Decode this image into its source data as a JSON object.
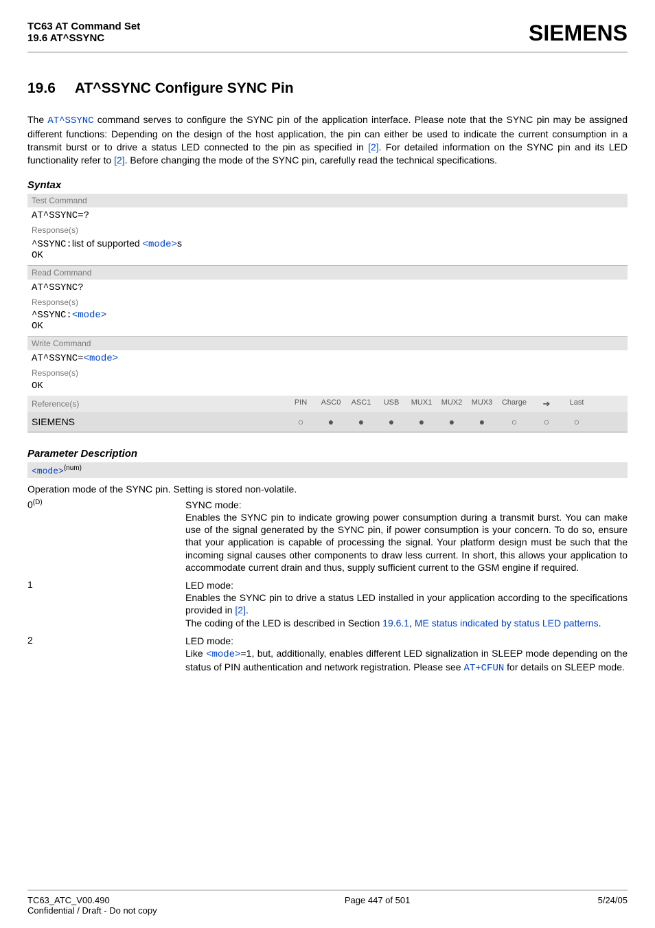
{
  "header": {
    "title": "TC63 AT Command Set",
    "subtitle": "19.6 AT^SSYNC",
    "brand": "SIEMENS"
  },
  "section": {
    "number": "19.6",
    "title": "AT^SSYNC   Configure SYNC Pin"
  },
  "intro": {
    "part1_a": "The ",
    "part1_cmd": "AT^SSYNC",
    "part1_b": " command serves to configure the SYNC pin of the application interface. Please note that the SYNC pin may be assigned different functions: Depending on the design of the host application, the pin can either be used to indicate the current consumption in a transmit burst or to drive a status LED connected to the pin as specified in ",
    "ref1": "[2]",
    "part1_c": ". For detailed information on the SYNC pin and its LED functionality refer to ",
    "ref2": "[2]",
    "part1_d": ". Before changing the mode of the SYNC pin, carefully read the technical specifications."
  },
  "syntax": {
    "heading": "Syntax",
    "test_label": "Test Command",
    "test_cmd": "AT^SSYNC=?",
    "resp_label": "Response(s)",
    "test_resp_a": "^SSYNC:",
    "test_resp_b": "list of supported ",
    "test_resp_mode": "<mode>",
    "test_resp_c": "s",
    "ok": "OK",
    "read_label": "Read Command",
    "read_cmd": "AT^SSYNC?",
    "read_resp_a": "^SSYNC:",
    "read_resp_mode": "<mode>",
    "write_label": "Write Command",
    "write_cmd_a": "AT^SSYNC=",
    "write_cmd_mode": "<mode>",
    "ref_label": "Reference(s)",
    "cols": [
      "PIN",
      "ASC0",
      "ASC1",
      "USB",
      "MUX1",
      "MUX2",
      "MUX3",
      "Charge",
      "➔",
      "Last"
    ],
    "siemens": "SIEMENS",
    "dots": [
      "○",
      "●",
      "●",
      "●",
      "●",
      "●",
      "●",
      "○",
      "○",
      "○"
    ]
  },
  "params": {
    "heading": "Parameter Description",
    "mode_tag": "<mode>",
    "mode_sup": "(num)",
    "note": "Operation mode of the SYNC pin. Setting is stored non-volatile.",
    "row0_key": "0",
    "row0_sup": "(D)",
    "row0_title": "SYNC mode:",
    "row0_body": "Enables the SYNC pin to indicate growing power consumption during a transmit burst. You can make use of the signal generated by the SYNC pin, if power consumption is your concern. To do so, ensure that your application is capable of processing the signal. Your platform design must be such that the incoming signal causes other components to draw less current. In short, this allows your application to accommodate current drain and thus, supply sufficient current to the GSM engine if required.",
    "row1_key": "1",
    "row1_title": "LED mode:",
    "row1_a": "Enables the SYNC pin to drive a status LED installed in your application according to the specifications provided in ",
    "row1_ref": "[2]",
    "row1_b": ".",
    "row1_c": "The coding of the LED is described in Section ",
    "row1_sec": "19.6.1",
    "row1_d": ", ",
    "row1_linktext": "ME status indicated by status LED patterns",
    "row1_e": ".",
    "row2_key": "2",
    "row2_title": "LED mode:",
    "row2_a": "Like ",
    "row2_mode": "<mode>",
    "row2_b": "=1, but, additionally, enables different LED signalization in SLEEP mode depending on the status of PIN authentication and network registration. Please see ",
    "row2_cmd": "AT+CFUN",
    "row2_c": " for details on SLEEP mode."
  },
  "footer": {
    "left": "TC63_ATC_V00.490",
    "left2": "Confidential / Draft - Do not copy",
    "center": "Page 447 of 501",
    "right": "5/24/05"
  }
}
